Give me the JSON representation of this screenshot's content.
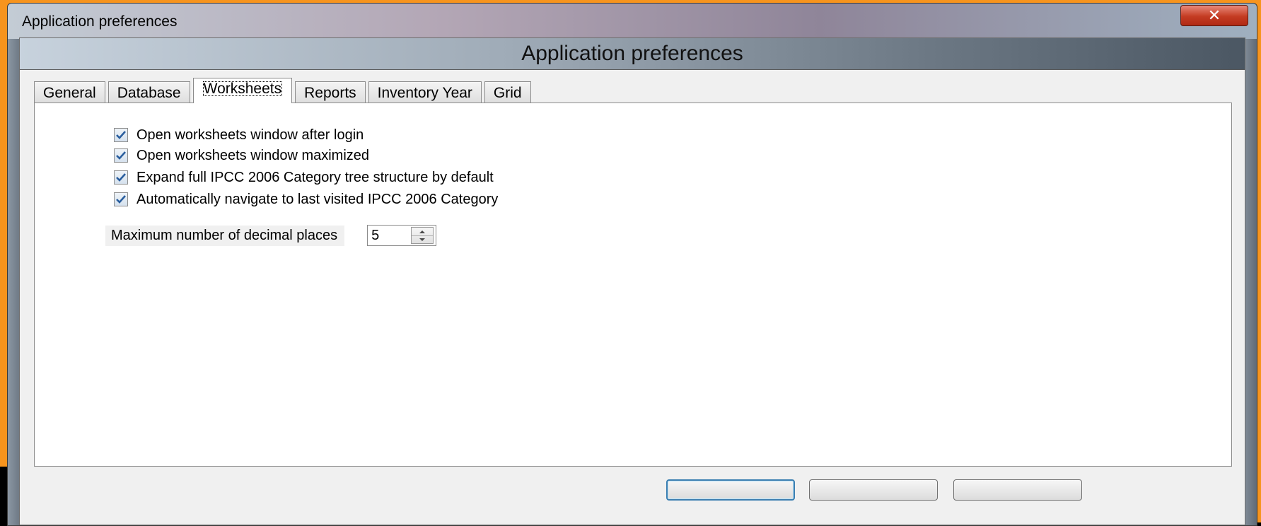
{
  "window": {
    "title": "Application preferences",
    "close_symbol": "✕"
  },
  "header": {
    "title": "Application preferences"
  },
  "tabs": [
    {
      "label": "General",
      "active": false
    },
    {
      "label": "Database",
      "active": false
    },
    {
      "label": "Worksheets",
      "active": true
    },
    {
      "label": "Reports",
      "active": false
    },
    {
      "label": "Inventory Year",
      "active": false
    },
    {
      "label": "Grid",
      "active": false
    }
  ],
  "worksheets": {
    "options": [
      {
        "label": "Open worksheets window after login",
        "checked": true
      },
      {
        "label": "Open worksheets window maximized",
        "checked": true
      },
      {
        "label": "Expand full IPCC 2006 Category tree structure by default",
        "checked": true
      },
      {
        "label": "Automatically navigate to last visited IPCC 2006 Category",
        "checked": true
      }
    ],
    "decimal_places": {
      "label": "Maximum number of decimal places",
      "value": "5"
    }
  },
  "icons": {
    "close": "close-icon",
    "check": "checkmark-icon",
    "up": "arrow-up-icon",
    "down": "arrow-down-icon"
  },
  "colors": {
    "desktop_accent": "#f7941d",
    "close_button": "#c43b22",
    "check_mark": "#2a5e9e",
    "default_button_border": "#3c7fb1"
  }
}
